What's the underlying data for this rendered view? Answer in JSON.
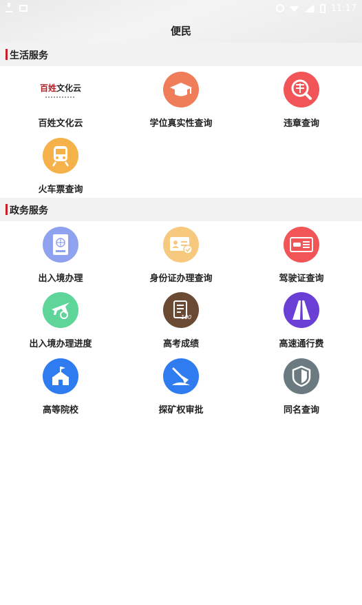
{
  "status_bar": {
    "time": "11:17"
  },
  "header": {
    "title": "便民"
  },
  "sections": [
    {
      "title": "生活服务",
      "items": [
        {
          "label": "百姓文化云",
          "logo_text_red": "百姓",
          "logo_text_dark": "文化云",
          "icon": "baixing-logo"
        },
        {
          "label": "学位真实性查询",
          "icon": "graduation-cap-icon",
          "color": "#F07D5A"
        },
        {
          "label": "违章查询",
          "icon": "violation-search-icon",
          "color": "#F25557"
        },
        {
          "label": "火车票查询",
          "icon": "train-icon",
          "color": "#F5B14A"
        }
      ]
    },
    {
      "title": "政务服务",
      "items": [
        {
          "label": "出入境办理",
          "icon": "passport-icon",
          "color": "#8FA2F0"
        },
        {
          "label": "身份证办理查询",
          "icon": "id-card-icon",
          "color": "#F7C97E"
        },
        {
          "label": "驾驶证查询",
          "icon": "driver-license-icon",
          "color": "#F25557"
        },
        {
          "label": "出入境办理进度",
          "icon": "airplane-icon",
          "color": "#5FD59A"
        },
        {
          "label": "高考成绩",
          "icon": "exam-score-icon",
          "color": "#6B4A33"
        },
        {
          "label": "高速通行费",
          "icon": "highway-icon",
          "color": "#6A3FD6"
        },
        {
          "label": "高等院校",
          "icon": "university-icon",
          "color": "#2F7CF0"
        },
        {
          "label": "探矿权审批",
          "icon": "mining-icon",
          "color": "#2F7CF0"
        },
        {
          "label": "同名查询",
          "icon": "shield-icon",
          "color": "#6A7A80"
        }
      ]
    }
  ]
}
